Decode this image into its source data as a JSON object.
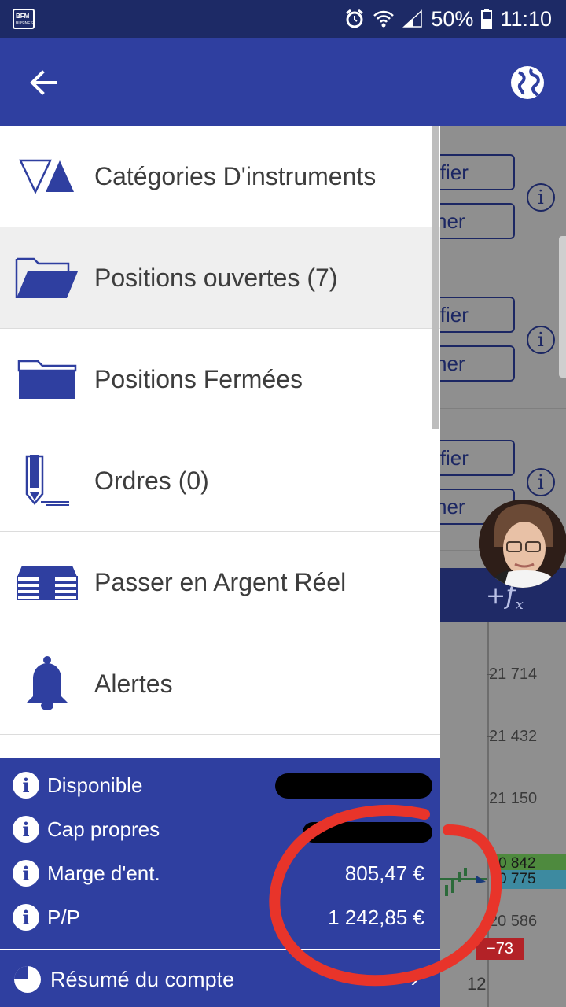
{
  "status_bar": {
    "battery": "50%",
    "time": "11:10"
  },
  "menu": [
    {
      "label": "Catégories D'instruments",
      "icon": "triangles-icon"
    },
    {
      "label": "Positions ouvertes (7)",
      "icon": "folder-open-icon",
      "active": true
    },
    {
      "label": "Positions Fermées",
      "icon": "folder-closed-icon"
    },
    {
      "label": "Ordres (0)",
      "icon": "pencil-icon"
    },
    {
      "label": "Passer en Argent Réel",
      "icon": "money-stack-icon"
    },
    {
      "label": "Alertes",
      "icon": "bell-icon"
    }
  ],
  "account": {
    "rows": [
      {
        "label": "Disponible",
        "value": ""
      },
      {
        "label": "Cap propres",
        "value": ""
      },
      {
        "label": "Marge d'ent.",
        "value": "805,47 €"
      },
      {
        "label": "P/P",
        "value": "1 242,85 €"
      }
    ],
    "summary_label": "Résumé du compte"
  },
  "background": {
    "buttons": [
      "ifier",
      "ner",
      "ifier",
      "ner",
      "ifier",
      "ner"
    ],
    "axis_ticks": [
      "21 714",
      "21 432",
      "21 150",
      "20 586"
    ],
    "price_tags": [
      "0 842",
      "0 775"
    ],
    "pl_tag": "−73",
    "date_label": "12"
  },
  "colors": {
    "primary": "#2f3fa0",
    "status_bar": "#1d2a66",
    "annotation": "#e8342a"
  }
}
